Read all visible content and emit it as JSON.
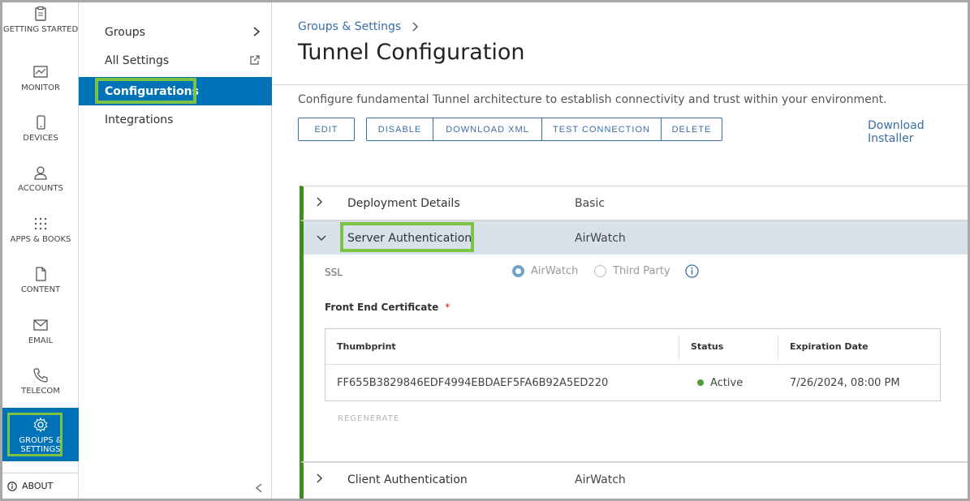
{
  "rail": {
    "items": [
      {
        "label": "GETTING STARTED",
        "icon": "clipboard-icon"
      },
      {
        "label": "MONITOR",
        "icon": "monitor-icon"
      },
      {
        "label": "DEVICES",
        "icon": "phone-icon"
      },
      {
        "label": "ACCOUNTS",
        "icon": "user-icon"
      },
      {
        "label": "APPS & BOOKS",
        "icon": "grid-icon"
      },
      {
        "label": "CONTENT",
        "icon": "document-icon"
      },
      {
        "label": "EMAIL",
        "icon": "envelope-icon"
      },
      {
        "label": "TELECOM",
        "icon": "telephone-icon"
      },
      {
        "label": "GROUPS & SETTINGS",
        "icon": "gear-icon"
      }
    ],
    "about": "ABOUT"
  },
  "subnav": {
    "items": [
      {
        "label": "Groups"
      },
      {
        "label": "All Settings"
      },
      {
        "label": "Configurations"
      },
      {
        "label": "Integrations"
      }
    ]
  },
  "main": {
    "breadcrumb": "Groups & Settings",
    "title": "Tunnel Configuration",
    "description": "Configure fundamental Tunnel architecture to establish connectivity and trust within your environment.",
    "buttons": {
      "edit": "EDIT",
      "disable": "DISABLE",
      "download_xml": "DOWNLOAD XML",
      "test_connection": "TEST CONNECTION",
      "delete": "DELETE"
    },
    "download_installer": "Download Installer"
  },
  "sections": {
    "deployment": {
      "label": "Deployment Details",
      "value": "Basic"
    },
    "server_auth": {
      "label": "Server Authentication",
      "value": "AirWatch",
      "ssl_label": "SSL",
      "ssl_options": [
        "AirWatch",
        "Third Party"
      ],
      "ssl_selected": "AirWatch",
      "front_end_label": "Front End Certificate",
      "required_mark": "*",
      "table": {
        "headers": [
          "Thumbprint",
          "Status",
          "Expiration Date"
        ],
        "row": {
          "thumbprint": "FF655B3829846EDF4994EBDAEF5FA6B92A5ED220",
          "status": "Active",
          "expiration": "7/26/2024, 08:00 PM"
        }
      },
      "regenerate": "REGENERATE"
    },
    "client_auth": {
      "label": "Client Authentication",
      "value": "AirWatch"
    }
  },
  "colors": {
    "accent": "#0072b8",
    "highlight": "#7dc242",
    "link": "#3a6ea5",
    "active_status": "#4e9a2a",
    "section_bar": "#3c8c1e"
  }
}
